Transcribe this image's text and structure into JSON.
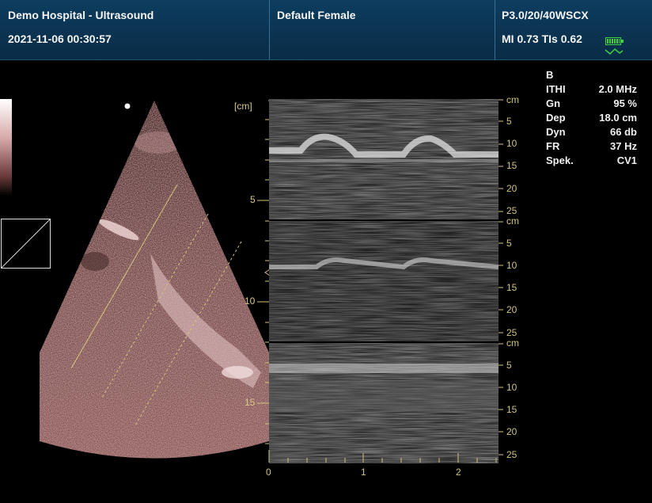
{
  "header": {
    "hospital": "Demo Hospital - Ultrasound",
    "datetime": "2021-11-06 00:30:57",
    "preset": "Default Female",
    "probe": "P3.0/20/40WSCX",
    "mi_tis": "MI 0.73  TIs 0.62"
  },
  "params": {
    "mode": "B",
    "rows": [
      {
        "key": "ITHI",
        "value": "2.0 MHz"
      },
      {
        "key": "Gn",
        "value": "95 %"
      },
      {
        "key": "Dep",
        "value": "18.0 cm"
      },
      {
        "key": "Dyn",
        "value": "66 db"
      },
      {
        "key": "FR",
        "value": "37 Hz"
      },
      {
        "key": "Spek.",
        "value": "CV1"
      }
    ]
  },
  "depth_scale": {
    "unit": "[cm]",
    "labels": [
      "5",
      "10",
      "15"
    ]
  },
  "mmode": {
    "unit": "cm",
    "panel_ticks": [
      "5",
      "10",
      "15",
      "20",
      "25"
    ],
    "time_labels": [
      "0",
      "1",
      "2"
    ]
  },
  "colors": {
    "header_bg": "#0a2c47",
    "scale_color": "#d8c98a",
    "battery": "#3fcf3f"
  },
  "icons": [
    "battery-icon",
    "signal-wave-icon"
  ]
}
